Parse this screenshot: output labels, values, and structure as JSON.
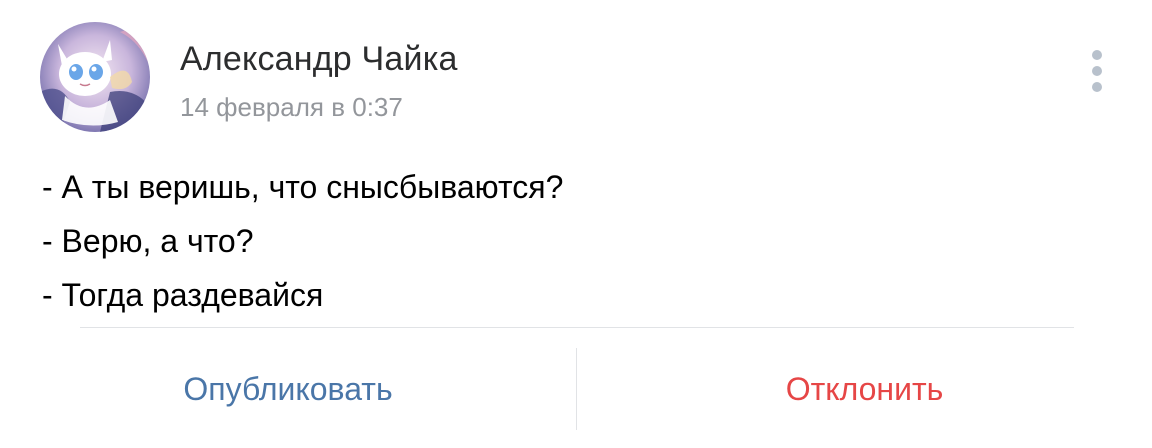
{
  "post": {
    "author_name": "Александр Чайка",
    "date": "14 февраля в 0:37",
    "avatar_icon": "anime-character-avatar",
    "more_icon": "vertical-dots-icon",
    "lines": [
      "- А ты веришь, что снысбываются?",
      "- Верю, а что?",
      "- Тогда раздевайся"
    ]
  },
  "actions": {
    "publish_label": "Опубликовать",
    "decline_label": "Отклонить"
  },
  "colors": {
    "publish": "#4a76a8",
    "decline": "#e64646",
    "date": "#93969b",
    "divider": "#e1e3e6"
  }
}
